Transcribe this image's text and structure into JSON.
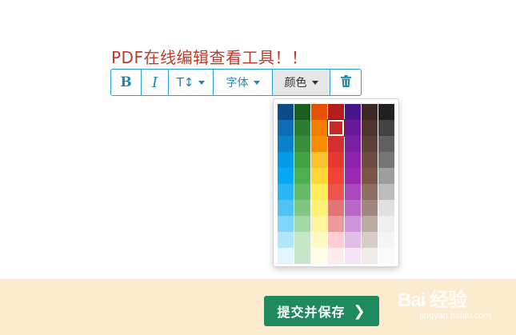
{
  "editor": {
    "text": "PDF在线编辑查看工具！！",
    "text_color": "#c0392b"
  },
  "toolbar": {
    "bold_label": "B",
    "italic_label": "I",
    "size_label": "T↕",
    "font_label": "字体",
    "color_label": "颜色",
    "trash_icon": "trash-icon",
    "border_color": "#29a0d4",
    "icon_color": "#1d86b5"
  },
  "palette": {
    "selected_index": 10,
    "colors": [
      "#0d4a8a",
      "#1b5e20",
      "#e65100",
      "#b71c1c",
      "#4a148c",
      "#3e2723",
      "#212121",
      "#0e6cb5",
      "#2e7d32",
      "#f57c00",
      "#c62828",
      "#6a1b9a",
      "#4e342e",
      "#424242",
      "#0b80cc",
      "#388e3c",
      "#fb8c00",
      "#d32f2f",
      "#7b1fa2",
      "#5d4037",
      "#616161",
      "#039be5",
      "#43a047",
      "#fbc02d",
      "#e53935",
      "#8e24aa",
      "#6d4c41",
      "#757575",
      "#03a9f4",
      "#4caf50",
      "#fdd835",
      "#f44336",
      "#9c27b0",
      "#795548",
      "#9e9e9e",
      "#29b6f6",
      "#66bb6a",
      "#ffee58",
      "#ef5350",
      "#ab47bc",
      "#8d6e63",
      "#bdbdbd",
      "#4fc3f7",
      "#81c784",
      "#fff176",
      "#e57373",
      "#ba68c8",
      "#a1887f",
      "#e0e0e0",
      "#81d4fa",
      "#a5d6a7",
      "#fff59d",
      "#ef9a9a",
      "#ce93d8",
      "#bcaaa4",
      "#eeeeee",
      "#b3e5fc",
      "#c8e6c9",
      "#fff9c4",
      "#ffcdd2",
      "#e1bee7",
      "#d7ccc8",
      "#f5f5f5",
      "#e1f5fe",
      "#c8e6c9",
      "#fffde7",
      "#ffebee",
      "#f3e5f5",
      "#efebe9",
      "#fafafa"
    ]
  },
  "footer": {
    "submit_label": "提交并保存",
    "submit_icon": "chevron-right-icon",
    "button_color": "#1f8a5e",
    "background": "#fcebcf"
  },
  "watermark": {
    "main": "Bai 经验",
    "url": "jingyan.baidu.com"
  }
}
